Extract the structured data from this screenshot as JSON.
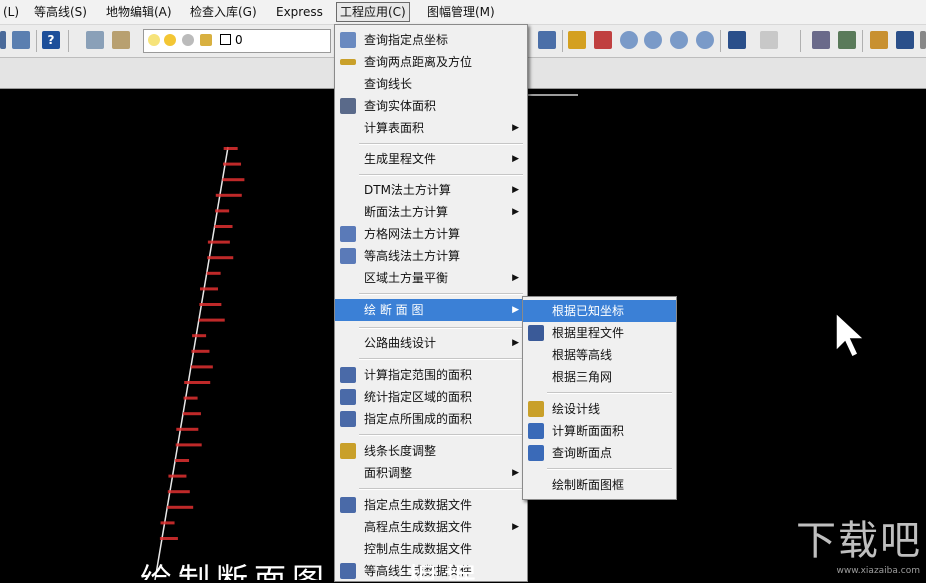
{
  "menubar": {
    "items": [
      "(L)",
      "等高线(S)",
      "地物编辑(A)",
      "检查入库(G)",
      "Express",
      "工程应用(C)",
      "图幅管理(M)"
    ]
  },
  "toolbar": {
    "layer_value": "0"
  },
  "menu": {
    "items": [
      {
        "label": "查询指定点坐标",
        "has_icon": true
      },
      {
        "label": "查询两点距离及方位",
        "has_icon": true
      },
      {
        "label": "查询线长",
        "has_icon": false
      },
      {
        "label": "查询实体面积",
        "has_icon": true
      },
      {
        "label": "计算表面积",
        "has_icon": false,
        "submenu": true
      },
      {
        "label": "生成里程文件",
        "has_icon": false,
        "submenu": true
      },
      {
        "label": "DTM法土方计算",
        "has_icon": false,
        "submenu": true
      },
      {
        "label": "断面法土方计算",
        "has_icon": false,
        "submenu": true
      },
      {
        "label": "方格网法土方计算",
        "has_icon": true
      },
      {
        "label": "等高线法土方计算",
        "has_icon": true
      },
      {
        "label": "区域土方量平衡",
        "has_icon": false,
        "submenu": true
      },
      {
        "label": "绘 断 面 图",
        "has_icon": false,
        "submenu": true,
        "highlighted": true
      },
      {
        "label": "公路曲线设计",
        "has_icon": false,
        "submenu": true
      },
      {
        "label": "计算指定范围的面积",
        "has_icon": true
      },
      {
        "label": "统计指定区域的面积",
        "has_icon": true
      },
      {
        "label": "指定点所围成的面积",
        "has_icon": true
      },
      {
        "label": "线条长度调整",
        "has_icon": true
      },
      {
        "label": "面积调整",
        "has_icon": false,
        "submenu": true
      },
      {
        "label": "指定点生成数据文件",
        "has_icon": true
      },
      {
        "label": "高程点生成数据文件",
        "has_icon": false,
        "submenu": true
      },
      {
        "label": "控制点生成数据文件",
        "has_icon": false
      },
      {
        "label": "等高线生成数据文件",
        "has_icon": true
      }
    ]
  },
  "submenu": {
    "items": [
      {
        "label": "根据已知坐标",
        "has_icon": false,
        "highlighted": true
      },
      {
        "label": "根据里程文件",
        "has_icon": true
      },
      {
        "label": "根据等高线",
        "has_icon": false
      },
      {
        "label": "根据三角网",
        "has_icon": false
      },
      {
        "label": "绘设计线",
        "has_icon": true
      },
      {
        "label": "计算断面面积",
        "has_icon": true
      },
      {
        "label": "查询断面点",
        "has_icon": true
      },
      {
        "label": "绘制断面图框",
        "has_icon": false
      }
    ]
  },
  "caption": "绘制断面图……根据",
  "watermark": "下载吧",
  "watermark_url": "www.xiazaiba.com",
  "colors": {
    "highlight": "#3b80d6",
    "points": "#e03030",
    "menu_bg": "#f0f0f0"
  }
}
